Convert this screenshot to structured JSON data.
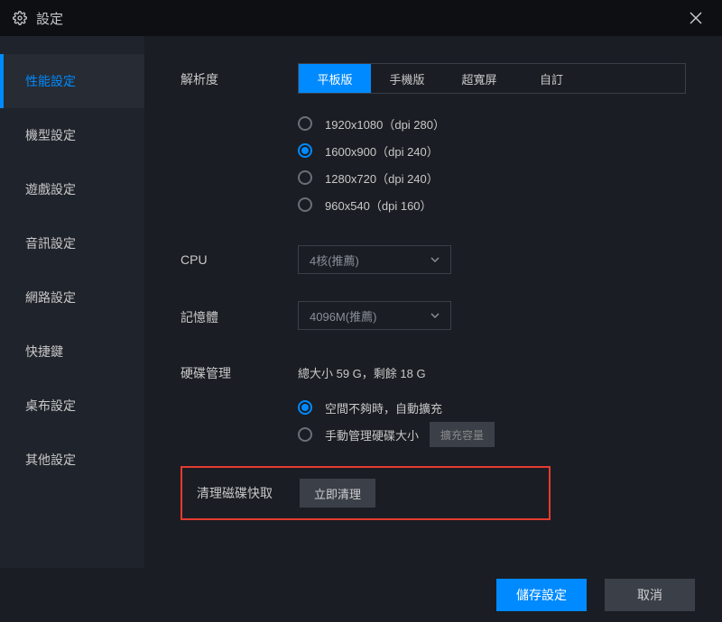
{
  "window": {
    "title": "設定"
  },
  "sidebar": {
    "items": [
      {
        "label": "性能設定",
        "active": true
      },
      {
        "label": "機型設定",
        "active": false
      },
      {
        "label": "遊戲設定",
        "active": false
      },
      {
        "label": "音訊設定",
        "active": false
      },
      {
        "label": "網路設定",
        "active": false
      },
      {
        "label": "快捷鍵",
        "active": false
      },
      {
        "label": "桌布設定",
        "active": false
      },
      {
        "label": "其他設定",
        "active": false
      }
    ]
  },
  "resolution": {
    "label": "解析度",
    "tabs": [
      {
        "label": "平板版",
        "active": true
      },
      {
        "label": "手機版",
        "active": false
      },
      {
        "label": "超寬屏",
        "active": false
      },
      {
        "label": "自訂",
        "active": false
      }
    ],
    "options": [
      {
        "label": "1920x1080（dpi 280）",
        "checked": false
      },
      {
        "label": "1600x900（dpi 240）",
        "checked": true
      },
      {
        "label": "1280x720（dpi 240）",
        "checked": false
      },
      {
        "label": "960x540（dpi 160）",
        "checked": false
      }
    ]
  },
  "cpu": {
    "label": "CPU",
    "selected": "4核(推薦)"
  },
  "memory": {
    "label": "記憶體",
    "selected": "4096M(推薦)"
  },
  "disk": {
    "label": "硬碟管理",
    "status": "總大小 59 G，剩餘 18 G",
    "options": [
      {
        "label": "空間不夠時，自動擴充",
        "checked": true
      },
      {
        "label": "手動管理硬碟大小",
        "checked": false
      }
    ],
    "expand_btn": "擴充容量"
  },
  "cache": {
    "label": "清理磁碟快取",
    "button": "立即清理"
  },
  "footer": {
    "save": "儲存設定",
    "cancel": "取消"
  }
}
